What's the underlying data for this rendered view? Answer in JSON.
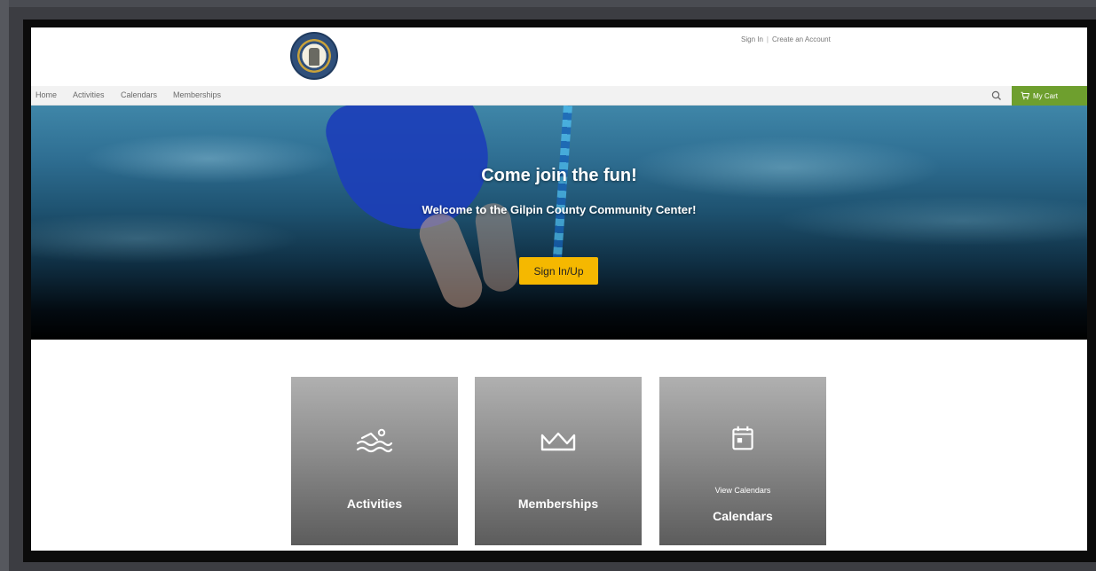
{
  "header": {
    "logo_name": "county-seal-logo",
    "account_links": {
      "sign_in": "Sign In",
      "separator": "|",
      "create_account": "Create an Account"
    }
  },
  "nav": {
    "items": [
      {
        "label": "Home"
      },
      {
        "label": "Activities"
      },
      {
        "label": "Calendars"
      },
      {
        "label": "Memberships"
      }
    ],
    "search_icon": "search-icon",
    "cart_label": "My Cart",
    "cart_color": "#6e9f2e"
  },
  "hero": {
    "title": "Come join the fun!",
    "subtitle": "Welcome to the Gilpin County Community Center!",
    "cta_label": "Sign In/Up",
    "cta_color": "#f5b800"
  },
  "tiles": [
    {
      "label": "Activities",
      "icon": "swimmer-icon"
    },
    {
      "label": "Memberships",
      "icon": "crown-icon"
    },
    {
      "label": "Calendars",
      "sublabel": "View Calendars",
      "icon": "calendar-icon"
    }
  ]
}
